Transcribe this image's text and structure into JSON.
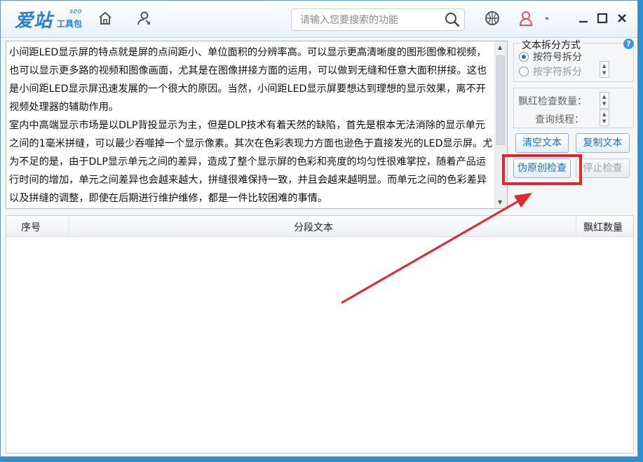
{
  "app": {
    "logo_main": "爱站",
    "logo_seo": "seo",
    "logo_sub": "工具包"
  },
  "search": {
    "placeholder": "请输入您要搜索的功能"
  },
  "textarea": {
    "paragraphs": [
      "小间距LED显示屏的特点就是屏的点间距小、单位面积的分辨率高。可以显示更高清晰度的图形图像和视频，也可以显示更多路的视频和图像画面，尤其是在图像拼接方面的运用，可以做到无缝和任意大面积拼接。这也是小间距LED显示屏迅速发展的一个很大的原因。当然，小间距LED显示屏要想达到理想的显示效果，离不开视频处理器的辅助作用。",
      "室内中高端显示市场是以DLP背投显示为主，但是DLP技术有着天然的缺陷，首先是根本无法消除的显示单元之间的1毫米拼缝，可以最少吞噬掉一个显示像素。其次在色彩表现力方面也逊色于直接发光的LED显示屏。尤为不足的是，由于DLP显示单元之间的差异，造成了整个显示屏的色彩和亮度的均匀性很难掌控，随着产品运行时间的增加，单元之间差异也会越来越大，拼缝很难保持一致，并且会越来越明显。而单元之间的色彩差异以及拼缝的调整，即使在后期进行维护维修，都是一件比较困难的事情。"
    ]
  },
  "split_group": {
    "title": "文本拆分方式",
    "option_symbol": "按符号拆分",
    "option_char": "按字符拆分",
    "selected": "按符号拆分"
  },
  "settings": {
    "check_count_label": "飘红检查数量：",
    "threads_label": "查询线程："
  },
  "buttons": {
    "clear": "清空文本",
    "copy": "复制文本",
    "check": "伪原创检查",
    "stop": "停止检查"
  },
  "table": {
    "columns": [
      "序号",
      "分段文本",
      "飘红数量"
    ],
    "rows": []
  },
  "colors": {
    "highlight": "#e5262c",
    "accent": "#1d6fc2"
  }
}
